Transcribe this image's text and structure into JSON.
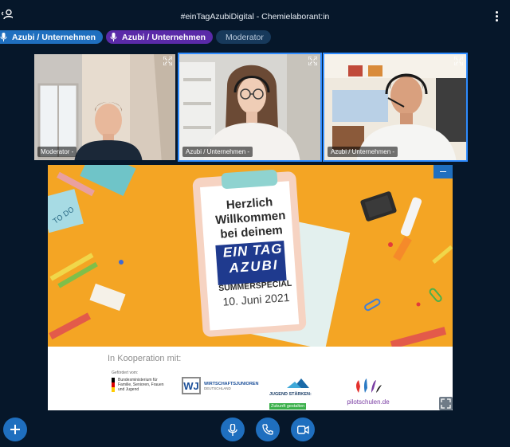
{
  "header": {
    "title": "#einTagAzubiDigital - Chemielaborant:in"
  },
  "participants_bar": [
    {
      "label": "Azubi / Unternehmen",
      "color": "#1f6fbf"
    },
    {
      "label": "Azubi / Unternehmen",
      "color": "#5a2aa8"
    },
    {
      "label": "Moderator",
      "color": "#17395b"
    }
  ],
  "video_tiles": [
    {
      "label": "Moderator -",
      "active": false
    },
    {
      "label": "Azubi / Unternehmen -",
      "active": true
    },
    {
      "label": "Azubi / Unternehmen -",
      "active": true
    }
  ],
  "presentation": {
    "line1": "Herzlich",
    "line2": "Willkommen",
    "line3": "bei deinem",
    "event_line1": "EIN TAG",
    "event_line2": "AZUBI",
    "special": "SUMMERSPECIAL",
    "date": "10. Juni 2021",
    "sticky_note": "TO DO",
    "cooperation_label": "In Kooperation mit:",
    "logos": {
      "ministry_label": "Gefördert vom:",
      "ministry_name": "Bundesministerium für Familie, Senioren, Frauen und Jugend",
      "wj_title": "WIRTSCHAFTSJUNIOREN",
      "wj_sub": "DEUTSCHLAND",
      "youth_title": "JUGEND STÄRKEN:",
      "youth_sub": "Zukunft gestalten",
      "pilot": "pilotschulen.de"
    }
  },
  "colors": {
    "background": "#06172a",
    "accent": "#1f6fbf",
    "slide_orange": "#f4a524"
  }
}
